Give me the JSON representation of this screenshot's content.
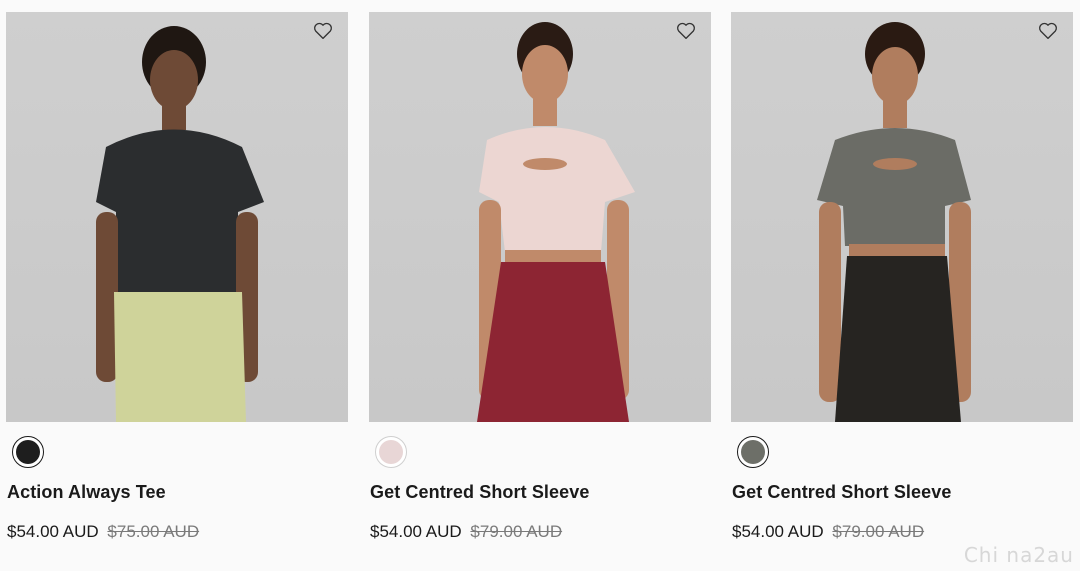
{
  "products": [
    {
      "name": "Action Always Tee",
      "price": "$54.00 AUD",
      "was_price": "$75.00 AUD",
      "swatch_color": "#1e1e1e",
      "top_color": "#2b2d2f",
      "bottom_color": "#cfd39a",
      "skin_color": "#6e4a36",
      "hair_color": "#1f1712"
    },
    {
      "name": "Get Centred Short Sleeve",
      "price": "$54.00 AUD",
      "was_price": "$79.00 AUD",
      "swatch_color": "#e8d6d6",
      "top_color": "#ecd6d2",
      "bottom_color": "#8d2533",
      "skin_color": "#c08a6a",
      "hair_color": "#2a1b14"
    },
    {
      "name": "Get Centred Short Sleeve",
      "price": "$54.00 AUD",
      "was_price": "$79.00 AUD",
      "swatch_color": "#6d6f68",
      "top_color": "#6b6c66",
      "bottom_color": "#262421",
      "skin_color": "#b07d5e",
      "hair_color": "#2a1a12"
    }
  ],
  "wishlist_icon": "heart-outline-icon",
  "watermark": "Chi na2au"
}
